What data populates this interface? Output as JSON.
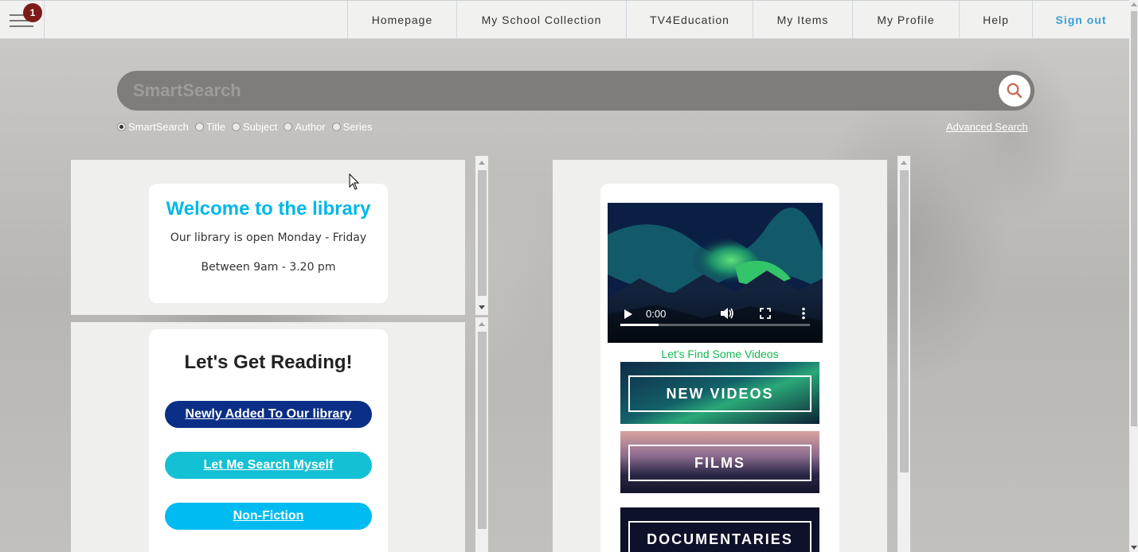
{
  "nav": {
    "badge_count": "1",
    "items": [
      {
        "label": "Homepage"
      },
      {
        "label": "My School Collection"
      },
      {
        "label": "TV4Education"
      },
      {
        "label": "My Items"
      },
      {
        "label": "My Profile"
      },
      {
        "label": "Help"
      },
      {
        "label": "Sign out"
      }
    ]
  },
  "search": {
    "placeholder": "SmartSearch",
    "options": [
      {
        "label": "SmartSearch",
        "checked": true
      },
      {
        "label": "Title",
        "checked": false
      },
      {
        "label": "Subject",
        "checked": false
      },
      {
        "label": "Author",
        "checked": false
      },
      {
        "label": "Series",
        "checked": false
      }
    ],
    "advanced_label": "Advanced Search"
  },
  "welcome": {
    "title": "Welcome to the library",
    "line1": "Our library is open Monday - Friday",
    "line2": "Between 9am - 3.20 pm"
  },
  "reading": {
    "title": "Let's Get Reading!",
    "buttons": [
      {
        "label": "Newly Added To Our library",
        "color": "#0b2f86"
      },
      {
        "label": "Let Me Search Myself",
        "color": "#14c0d3"
      },
      {
        "label": "Non-Fiction",
        "color": "#00bbf2"
      }
    ]
  },
  "video": {
    "time": "0:00",
    "progress": 0.2,
    "caption": "Let's Find Some Videos",
    "tiles": [
      {
        "label": "NEW VIDEOS"
      },
      {
        "label": "FILMS"
      },
      {
        "label": "DOCUMENTARIES"
      }
    ]
  },
  "colors": {
    "accent_blue": "#00b7e8",
    "signout": "#3ba0d6",
    "caption_green": "#13b94f"
  }
}
